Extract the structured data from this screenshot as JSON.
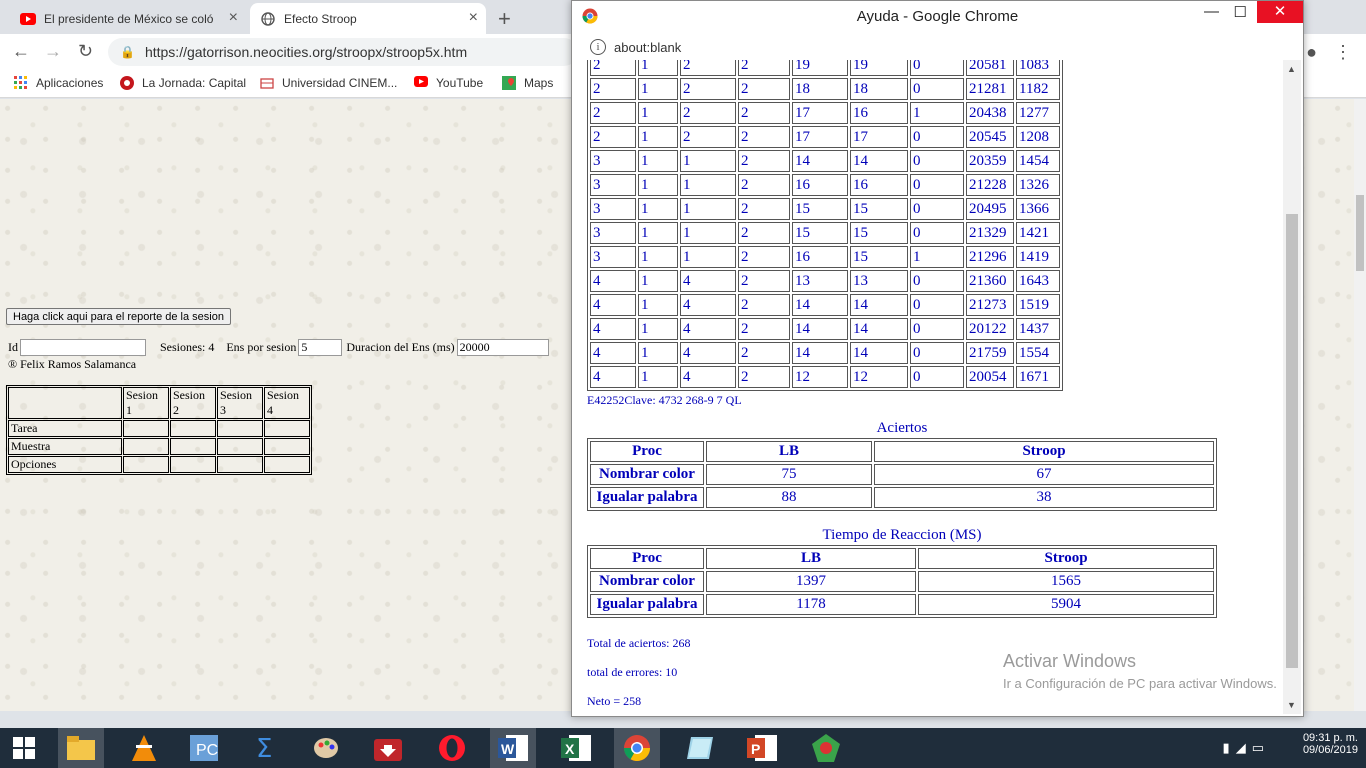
{
  "browser": {
    "tabs": [
      {
        "title": "El presidente de México se coló a",
        "icon": "youtube-icon"
      },
      {
        "title": "Efecto Stroop",
        "icon": "globe-icon"
      }
    ],
    "url": "https://gatorrison.neocities.org/stroopx/stroop5x.htm",
    "bookmarks": [
      {
        "label": "Aplicaciones",
        "icon": "apps-grid-icon"
      },
      {
        "label": "La Jornada: Capital",
        "icon": "jornada-icon"
      },
      {
        "label": "Universidad CINEM...",
        "icon": "university-icon"
      },
      {
        "label": "YouTube",
        "icon": "youtube-icon"
      },
      {
        "label": "Maps",
        "icon": "maps-icon"
      }
    ]
  },
  "page": {
    "report_button": "Haga click aqui para el reporte de la sesion",
    "id_label": "Id",
    "id_value": "",
    "sessions_text": "Sesiones: 4",
    "ens_label": "Ens por sesion",
    "ens_value": "5",
    "duration_label": "Duracion del Ens (ms)",
    "duration_value": "20000",
    "author": "® Felix Ramos Salamanca",
    "session_headers": [
      "",
      "Sesion 1",
      "Sesion 2",
      "Sesion 3",
      "Sesion 4"
    ],
    "session_rows": [
      "Tarea",
      "Muestra",
      "Opciones"
    ]
  },
  "popup": {
    "title": "Ayuda - Google Chrome",
    "url": "about:blank",
    "data_rows": [
      [
        "2",
        "1",
        "2",
        "2",
        "19",
        "19",
        "0",
        "20581",
        "1083"
      ],
      [
        "2",
        "1",
        "2",
        "2",
        "18",
        "18",
        "0",
        "21281",
        "1182"
      ],
      [
        "2",
        "1",
        "2",
        "2",
        "17",
        "16",
        "1",
        "20438",
        "1277"
      ],
      [
        "2",
        "1",
        "2",
        "2",
        "17",
        "17",
        "0",
        "20545",
        "1208"
      ],
      [
        "3",
        "1",
        "1",
        "2",
        "14",
        "14",
        "0",
        "20359",
        "1454"
      ],
      [
        "3",
        "1",
        "1",
        "2",
        "16",
        "16",
        "0",
        "21228",
        "1326"
      ],
      [
        "3",
        "1",
        "1",
        "2",
        "15",
        "15",
        "0",
        "20495",
        "1366"
      ],
      [
        "3",
        "1",
        "1",
        "2",
        "15",
        "15",
        "0",
        "21329",
        "1421"
      ],
      [
        "3",
        "1",
        "1",
        "2",
        "16",
        "15",
        "1",
        "21296",
        "1419"
      ],
      [
        "4",
        "1",
        "4",
        "2",
        "13",
        "13",
        "0",
        "21360",
        "1643"
      ],
      [
        "4",
        "1",
        "4",
        "2",
        "14",
        "14",
        "0",
        "21273",
        "1519"
      ],
      [
        "4",
        "1",
        "4",
        "2",
        "14",
        "14",
        "0",
        "20122",
        "1437"
      ],
      [
        "4",
        "1",
        "4",
        "2",
        "14",
        "14",
        "0",
        "21759",
        "1554"
      ],
      [
        "4",
        "1",
        "4",
        "2",
        "12",
        "12",
        "0",
        "20054",
        "1671"
      ]
    ],
    "clave": "E42252Clave: 4732 268-9 7 QL",
    "aciertos": {
      "caption": "Aciertos",
      "headers": [
        "Proc",
        "LB",
        "Stroop"
      ],
      "rows": [
        {
          "proc": "Nombrar color",
          "lb": "75",
          "stroop": "67"
        },
        {
          "proc": "Igualar palabra",
          "lb": "88",
          "stroop": "38"
        }
      ]
    },
    "tiempo": {
      "caption": "Tiempo de Reaccion (MS)",
      "headers": [
        "Proc",
        "LB",
        "Stroop"
      ],
      "rows": [
        {
          "proc": "Nombrar color",
          "lb": "1397",
          "stroop": "1565"
        },
        {
          "proc": "Igualar palabra",
          "lb": "1178",
          "stroop": "5904"
        }
      ]
    },
    "total_aciertos": "Total de aciertos: 268",
    "total_errores": "total de errores: 10",
    "neto": "Neto = 258"
  },
  "watermark": {
    "line1": "Activar Windows",
    "line2": "Ir a Configuración de PC para activar Windows."
  },
  "taskbar": {
    "time": "09:31 p. m.",
    "date": "09/06/2019",
    "apps": [
      "start-icon",
      "file-explorer-icon",
      "vlc-icon",
      "pc-app-icon",
      "sigma-app-icon",
      "paint-icon",
      "download-app-icon",
      "opera-icon",
      "word-icon",
      "excel-icon",
      "chrome-icon",
      "notes-app-icon",
      "powerpoint-icon",
      "game-app-icon"
    ]
  },
  "colors": {
    "link_blue": "#0000b8",
    "close_red": "#e81123",
    "taskbar": "#1f2d3b"
  }
}
